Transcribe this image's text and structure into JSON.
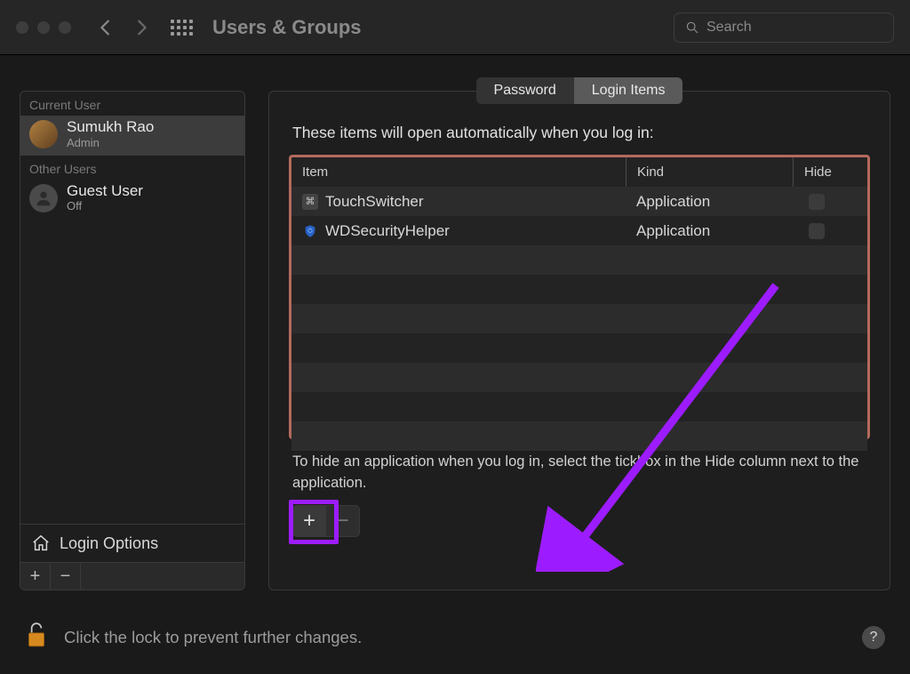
{
  "toolbar": {
    "title": "Users & Groups",
    "search_placeholder": "Search"
  },
  "sidebar": {
    "section_current": "Current User",
    "section_other": "Other Users",
    "current_user": {
      "name": "Sumukh Rao",
      "role": "Admin"
    },
    "other_user": {
      "name": "Guest User",
      "role": "Off"
    },
    "login_options": "Login Options"
  },
  "tabs": {
    "password": "Password",
    "login_items": "Login Items"
  },
  "main": {
    "hint": "These items will open automatically when you log in:",
    "col_item": "Item",
    "col_kind": "Kind",
    "col_hide": "Hide",
    "items": [
      {
        "name": "TouchSwitcher",
        "kind": "Application",
        "icon": "ts"
      },
      {
        "name": "WDSecurityHelper",
        "kind": "Application",
        "icon": "wd"
      }
    ],
    "hint2": "To hide an application when you log in, select the tickbox in the Hide column next to the application."
  },
  "footer": {
    "lock_text": "Click the lock to prevent further changes.",
    "help": "?"
  }
}
